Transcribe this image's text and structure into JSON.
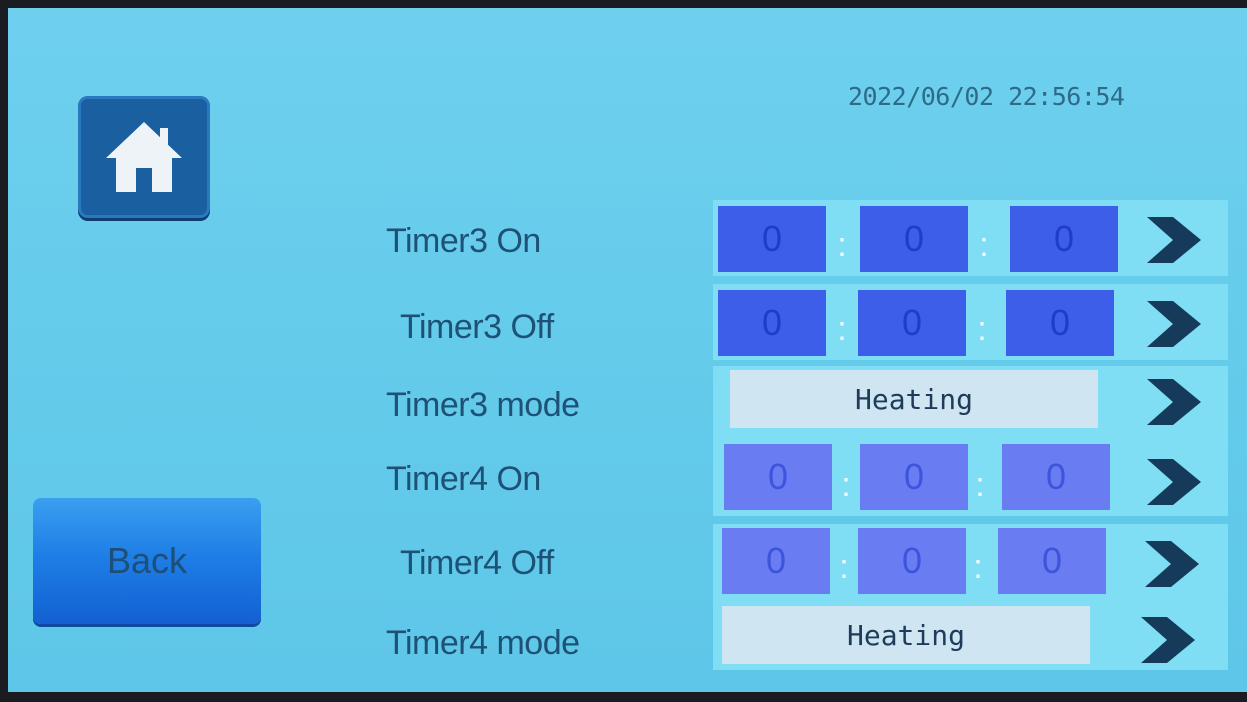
{
  "header": {
    "datetime": "2022/06/02 22:56:54"
  },
  "nav": {
    "home_icon": "home-icon",
    "back_label": "Back"
  },
  "rows": [
    {
      "label": "Timer3 On",
      "type": "time",
      "h": "0",
      "m": "0",
      "s": "0"
    },
    {
      "label": "Timer3 Off",
      "type": "time",
      "h": "0",
      "m": "0",
      "s": "0"
    },
    {
      "label": "Timer3 mode",
      "type": "mode",
      "value": "Heating"
    },
    {
      "label": "Timer4 On",
      "type": "time",
      "h": "0",
      "m": "0",
      "s": "0"
    },
    {
      "label": "Timer4 Off",
      "type": "time",
      "h": "0",
      "m": "0",
      "s": "0"
    },
    {
      "label": "Timer4 mode",
      "type": "mode",
      "value": "Heating"
    }
  ],
  "separator": ":",
  "icons": {
    "arrow": "chevron-right-icon"
  },
  "colors": {
    "background": "#64cbeb",
    "field_dark": "#3d5ee8",
    "field_light": "#6a7cf2",
    "arrow": "#163a5a"
  }
}
